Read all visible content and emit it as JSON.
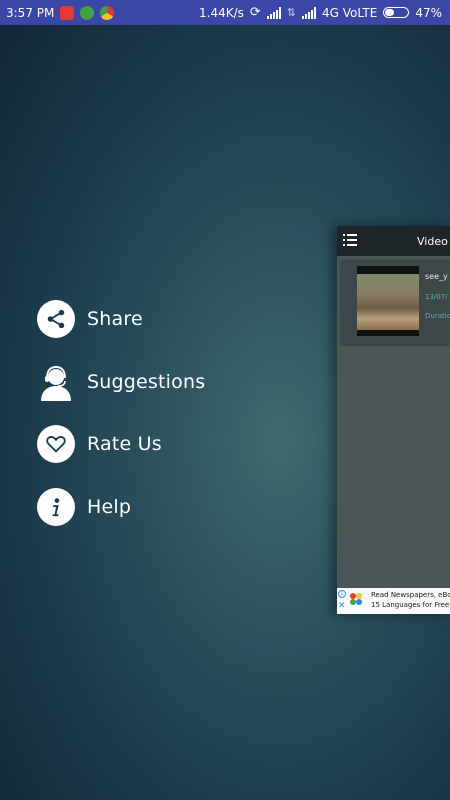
{
  "status_bar": {
    "time": "3:57 PM",
    "speed": "1.44K/s",
    "network": "4G VoLTE",
    "battery": "47%",
    "battery_level": 0.47
  },
  "menu": {
    "items": [
      {
        "label": "Share",
        "icon": "share-icon"
      },
      {
        "label": "Suggestions",
        "icon": "support-agent-icon"
      },
      {
        "label": "Rate Us",
        "icon": "heart-icon"
      },
      {
        "label": "Help",
        "icon": "info-icon"
      }
    ]
  },
  "preview": {
    "toolbar_title": "Video",
    "video": {
      "title": "see_y",
      "date": "13/07/",
      "duration": "Duratio"
    },
    "ad": {
      "line1": "Read Newspapers, eBoo",
      "line2": "15 Languages for Free."
    }
  },
  "colors": {
    "status_bar": "#3b47a6",
    "accent": "#4db6ac",
    "panel": "#4b5659"
  }
}
